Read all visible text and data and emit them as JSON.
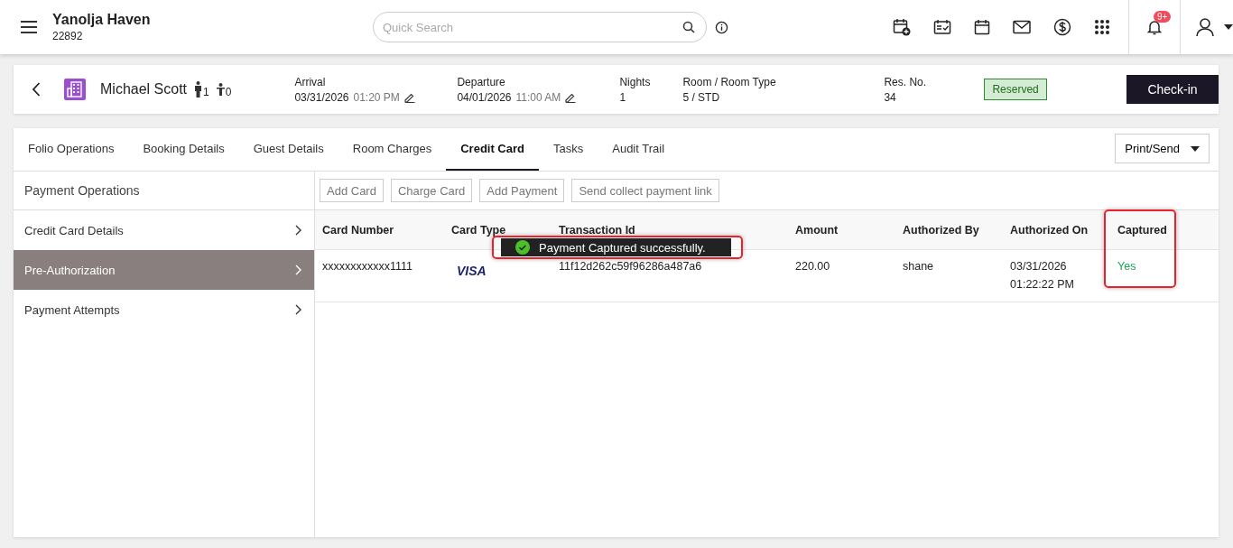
{
  "header": {
    "property": "Yanolja Haven",
    "property_code": "22892",
    "search": {
      "placeholder": "Quick Search"
    },
    "notification_badge": "9+"
  },
  "reservation": {
    "guest": "Michael Scott",
    "adults": "1",
    "children": "0",
    "fields": [
      {
        "label": "Arrival",
        "value": "03/31/2026",
        "time": "01:20 PM",
        "editable": true
      },
      {
        "label": "Departure",
        "value": "04/01/2026",
        "time": "11:00 AM",
        "editable": true
      },
      {
        "label": "Nights",
        "value": "1",
        "editable": false
      },
      {
        "label": "Room / Room Type",
        "value": "5 / STD",
        "editable": false
      },
      {
        "label": "Res. No.",
        "value": "34",
        "editable": false
      }
    ],
    "status": "Reserved",
    "action": "Check-in"
  },
  "tabs": [
    {
      "label": "Folio Operations",
      "selected": false
    },
    {
      "label": "Booking Details",
      "selected": false
    },
    {
      "label": "Guest Details",
      "selected": false
    },
    {
      "label": "Room Charges",
      "selected": false
    },
    {
      "label": "Credit Card",
      "selected": true
    },
    {
      "label": "Tasks",
      "selected": false
    },
    {
      "label": "Audit Trail",
      "selected": false
    }
  ],
  "print_menu": "Print/Send",
  "sidebar": {
    "title": "Payment Operations",
    "items": [
      {
        "label": "Credit Card Details",
        "selected": false
      },
      {
        "label": "Pre-Authorization",
        "selected": true
      },
      {
        "label": "Payment Attempts",
        "selected": false
      }
    ]
  },
  "actions": [
    "Add Card",
    "Charge Card",
    "Add Payment",
    "Send collect payment link"
  ],
  "table": {
    "columns": [
      {
        "label": "Card Number"
      },
      {
        "label": "Card Type"
      },
      {
        "label": "Transaction Id"
      },
      {
        "label": "Amount"
      },
      {
        "label": "Authorized By"
      },
      {
        "label": "Authorized On"
      },
      {
        "label": "Captured",
        "highlighted": true
      }
    ],
    "rows": [
      {
        "card_number": "xxxxxxxxxxxx1111",
        "card_type": "VISA",
        "transaction_id": "11f12d262c59f96286a487a6",
        "amount": "220.00",
        "authorized_by": "shane",
        "authorized_on": [
          "03/31/2026",
          "01:22:22 PM"
        ],
        "captured": "Yes",
        "captured_ok": true
      }
    ]
  },
  "toast": {
    "message": "Payment Captured successfully.",
    "highlighted": true
  }
}
